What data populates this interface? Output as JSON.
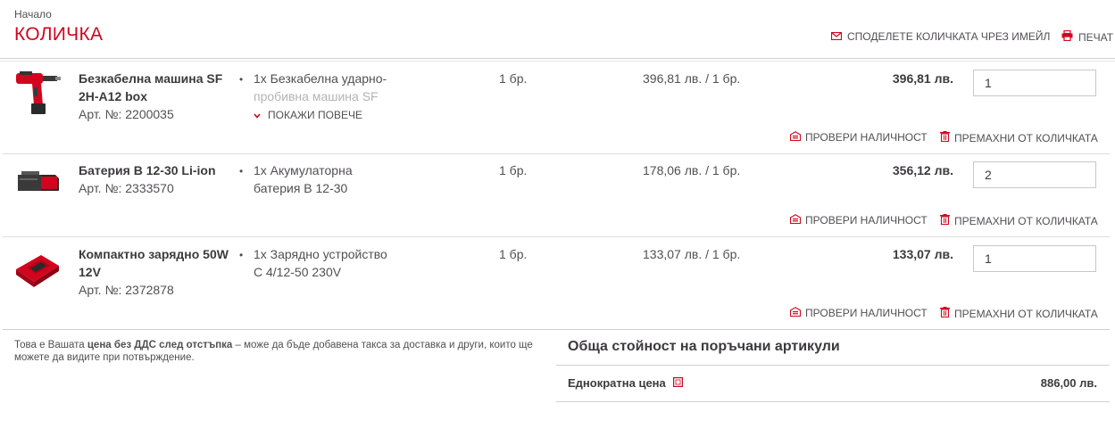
{
  "header": {
    "breadcrumb": "Начало",
    "title": "КОЛИЧКА",
    "share_label": "СПОДЕЛЕТЕ КОЛИЧКАТА ЧРЕЗ ИМЕЙЛ",
    "print_label": "ПЕЧАТ"
  },
  "items": [
    {
      "name": "Безкабелна машина SF 2H-A12 box",
      "article": "Арт. №: 2200035",
      "desc_line1": "1x Безкабелна ударно-",
      "desc_line2": "пробивна машина SF",
      "show_more": "ПОКАЖИ ПОВЕЧЕ",
      "qty_text": "1 бр.",
      "unit_price": "396,81 лв. / 1 бр.",
      "total": "396,81 лв.",
      "qty": "1",
      "check_label": "ПРОВЕРИ НАЛИЧНОСТ",
      "remove_label": "ПРЕМАХНИ ОТ КОЛИЧКАТА",
      "icon": "drill-icon"
    },
    {
      "name": "Батерия B 12-30 Li-ion",
      "article": "Арт. №: 2333570",
      "desc_line1": "1x Акумулаторна",
      "desc_line2": "батерия B 12-30",
      "qty_text": "1 бр.",
      "unit_price": "178,06 лв. / 1 бр.",
      "total": "356,12 лв.",
      "qty": "2",
      "check_label": "ПРОВЕРИ НАЛИЧНОСТ",
      "remove_label": "ПРЕМАХНИ ОТ КОЛИЧКАТА",
      "icon": "battery-icon"
    },
    {
      "name": "Компактно зарядно 50W 12V",
      "article": "Арт. №: 2372878",
      "desc_line1": "1x Зарядно устройство",
      "desc_line2": "C 4/12-50 230V",
      "qty_text": "1 бр.",
      "unit_price": "133,07 лв. / 1 бр.",
      "total": "133,07 лв.",
      "qty": "1",
      "check_label": "ПРОВЕРИ НАЛИЧНОСТ",
      "remove_label": "ПРЕМАХНИ ОТ КОЛИЧКАТА",
      "icon": "charger-icon"
    }
  ],
  "note": {
    "prefix": "Това е Вашата ",
    "bold": "цена без ДДС след отстъпка",
    "suffix": " – може да бъде добавена такса за доставка и други, които ще можете да видите при потвърждение."
  },
  "summary": {
    "title": "Обща стойност на поръчани артикули",
    "one_time_label": "Еднократна цена",
    "one_time_value": "886,00 лв."
  },
  "colors": {
    "accent": "#d2051e",
    "text": "#524f53"
  }
}
